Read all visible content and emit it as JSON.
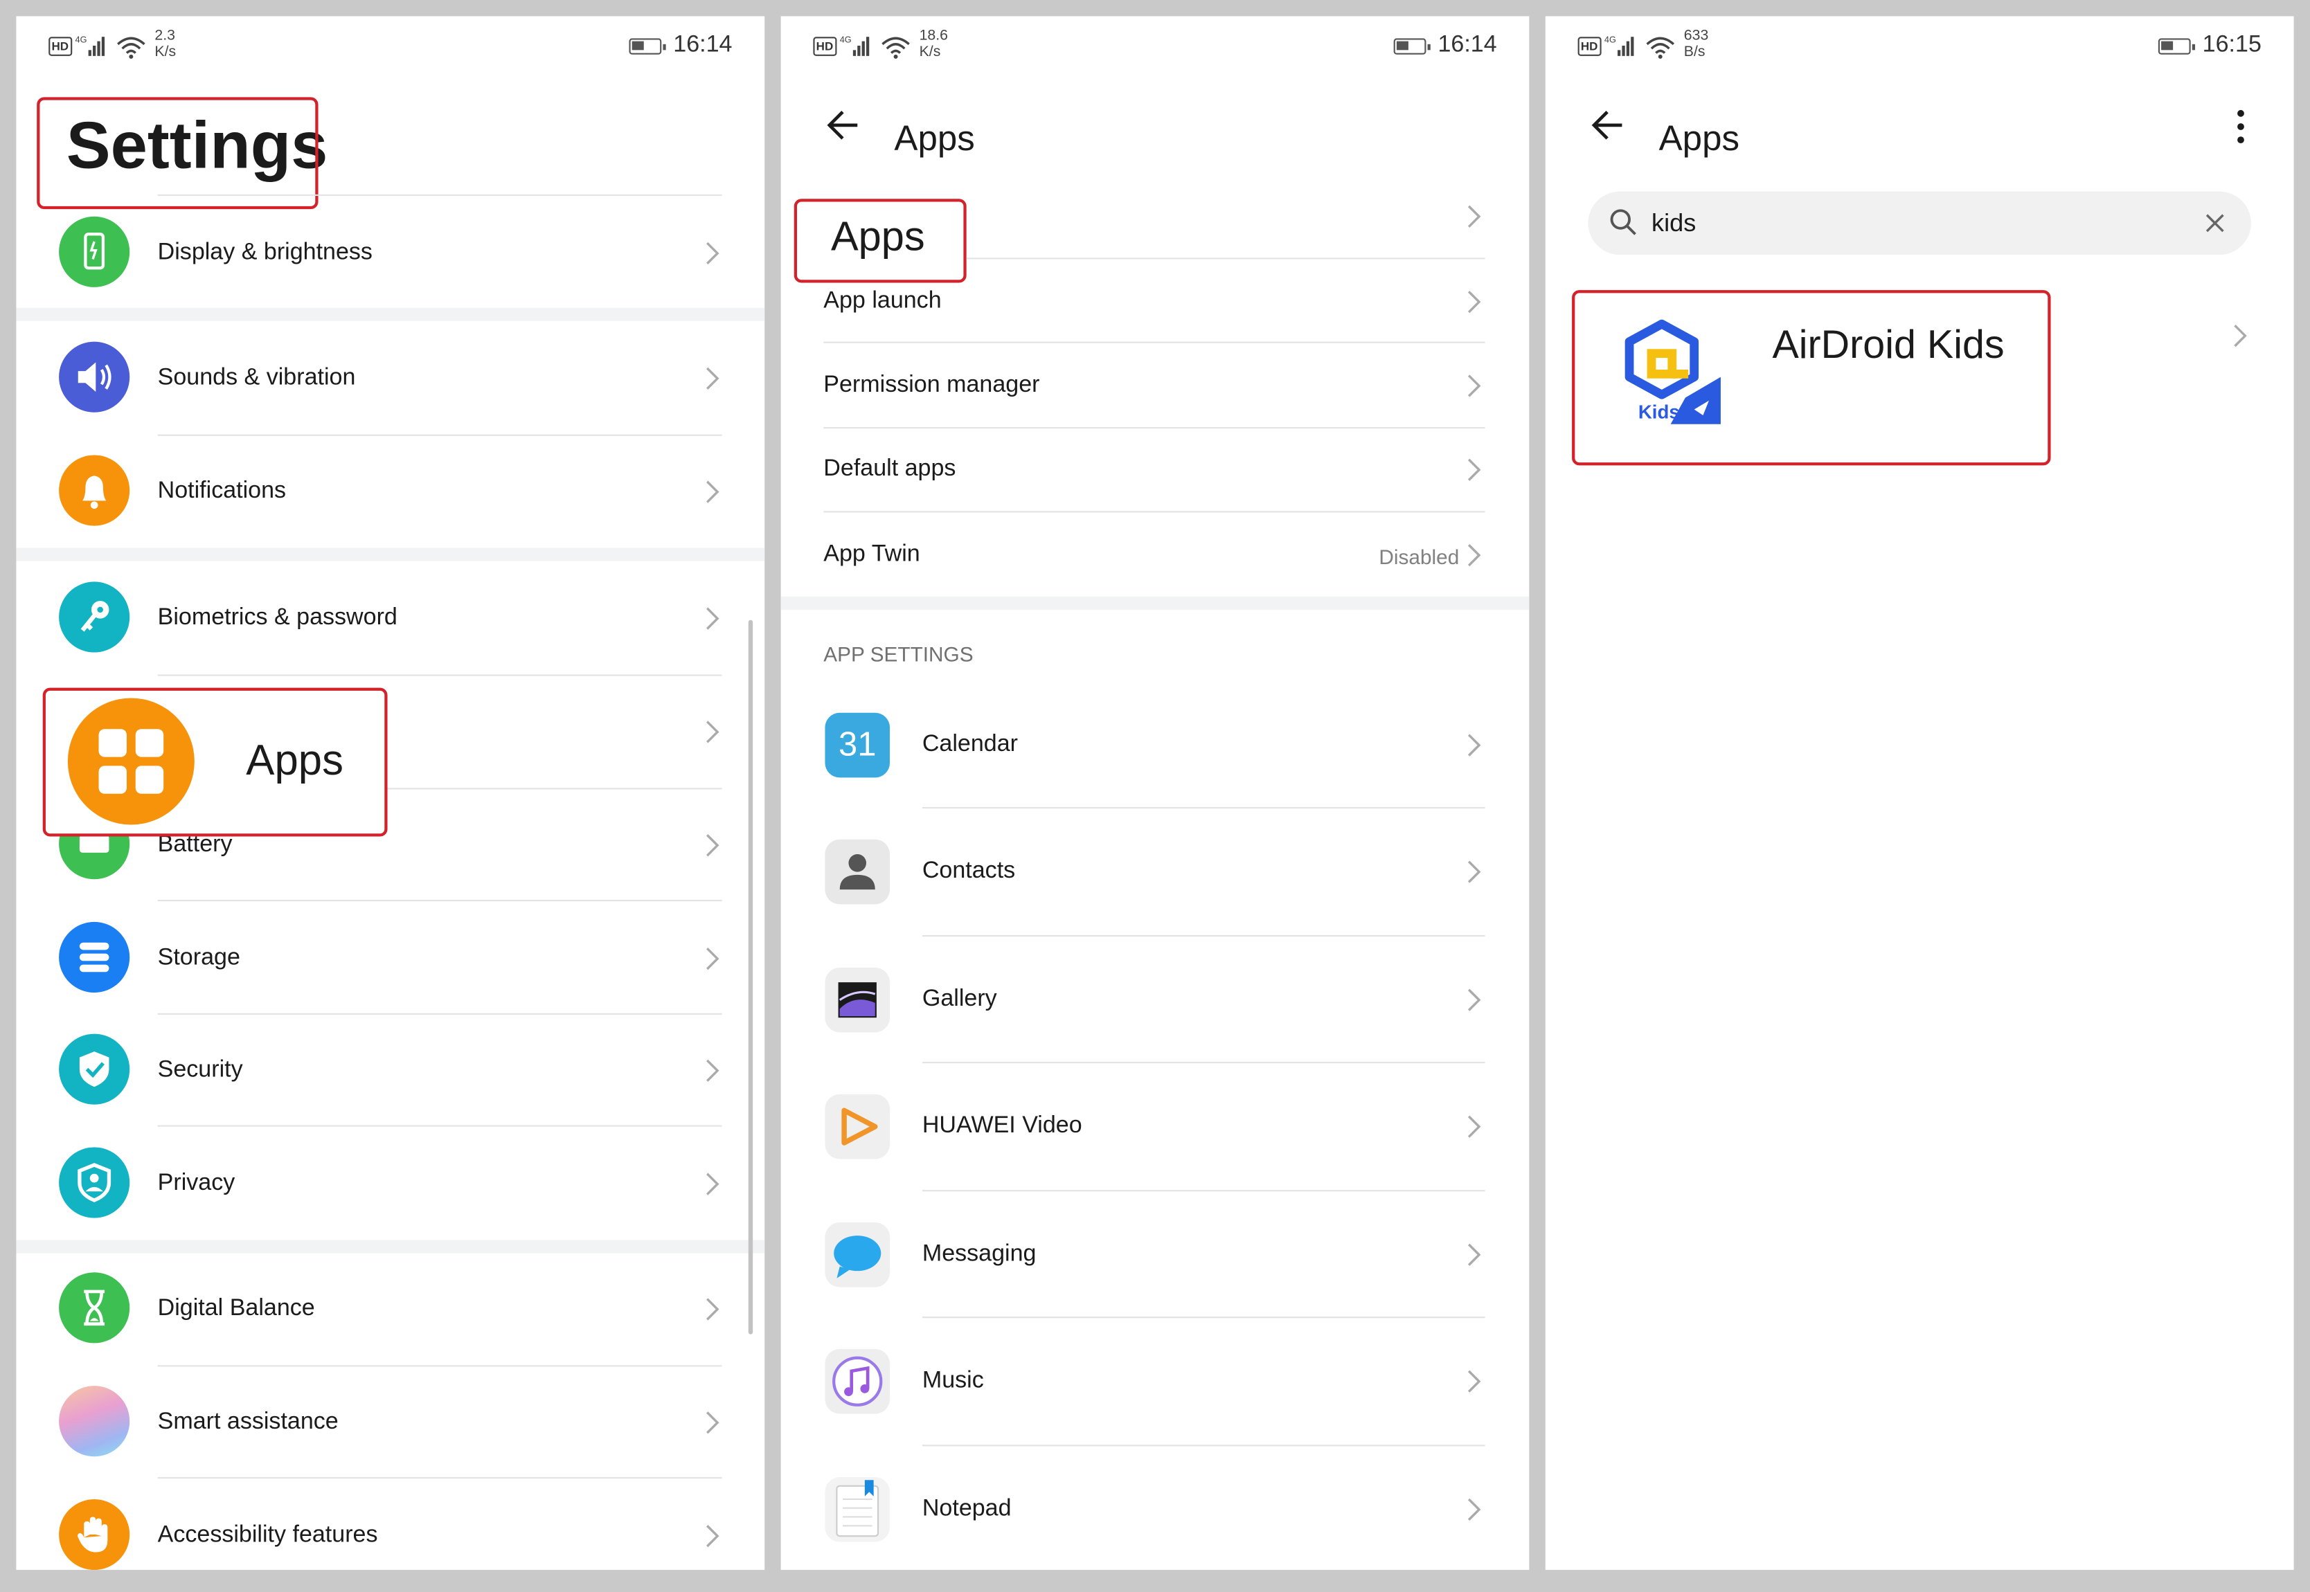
{
  "panel1": {
    "status": {
      "speed_value": "2.3",
      "speed_unit": "K/s",
      "time": "16:14",
      "network": "4G"
    },
    "title": "Settings",
    "items": [
      {
        "label": "Display & brightness",
        "icon": "display-icon",
        "color": "#3dbf52"
      },
      {
        "label": "Sounds & vibration",
        "icon": "speaker-icon",
        "color": "#4a5cd6"
      },
      {
        "label": "Notifications",
        "icon": "bell-icon",
        "color": "#f7930a"
      },
      {
        "label": "Biometrics & password",
        "icon": "key-icon",
        "color": "#12b3c2"
      },
      {
        "label": "Apps",
        "icon": "apps-grid-icon",
        "color": "#f7930a"
      },
      {
        "label": "Battery",
        "icon": "battery-icon",
        "color": "#3dbf52"
      },
      {
        "label": "Storage",
        "icon": "storage-icon",
        "color": "#1a7ff2"
      },
      {
        "label": "Security",
        "icon": "shield-check-icon",
        "color": "#12b3c2"
      },
      {
        "label": "Privacy",
        "icon": "privacy-shield-icon",
        "color": "#12b3c2"
      },
      {
        "label": "Digital Balance",
        "icon": "hourglass-icon",
        "color": "#3dbf52"
      },
      {
        "label": "Smart assistance",
        "icon": "smart-assistance-icon",
        "color": "#b8a5f0"
      },
      {
        "label": "Accessibility features",
        "icon": "hand-icon",
        "color": "#f7930a"
      }
    ],
    "callout_label": "Apps"
  },
  "panel2": {
    "status": {
      "speed_value": "18.6",
      "speed_unit": "K/s",
      "time": "16:14",
      "network": "4G"
    },
    "title": "Apps",
    "menu": [
      {
        "label": "Apps",
        "value": ""
      },
      {
        "label": "App launch",
        "value": ""
      },
      {
        "label": "Permission manager",
        "value": ""
      },
      {
        "label": "Default apps",
        "value": ""
      },
      {
        "label": "App Twin",
        "value": "Disabled"
      }
    ],
    "section_header": "APP SETTINGS",
    "apps": [
      {
        "label": "Calendar",
        "icon": "calendar-icon",
        "badge": "31"
      },
      {
        "label": "Contacts",
        "icon": "contacts-icon"
      },
      {
        "label": "Gallery",
        "icon": "gallery-icon"
      },
      {
        "label": "HUAWEI Video",
        "icon": "video-icon"
      },
      {
        "label": "Messaging",
        "icon": "messaging-icon"
      },
      {
        "label": "Music",
        "icon": "music-icon"
      },
      {
        "label": "Notepad",
        "icon": "notepad-icon"
      }
    ]
  },
  "panel3": {
    "status": {
      "speed_value": "633",
      "speed_unit": "B/s",
      "time": "16:15",
      "network": "4G"
    },
    "title": "Apps",
    "search": {
      "value": "kids"
    },
    "result": {
      "label": "AirDroid Kids",
      "icon_text": "Kids"
    }
  },
  "colors": {
    "highlight": "#d3222a",
    "background": "#c9c9c9"
  }
}
